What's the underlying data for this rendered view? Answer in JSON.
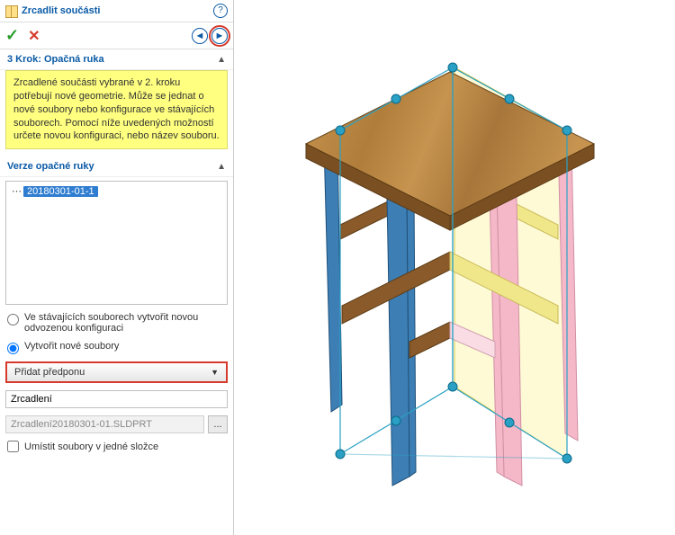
{
  "header": {
    "title": "Zrcadlit součásti"
  },
  "step": {
    "title": "3 Krok: Opačná ruka",
    "info": "Zrcadlené součásti vybrané v 2. kroku potřebují nové geometrie. Může se jednat o nové soubory nebo konfigurace ve stávajících souborech. Pomocí níže uvedených možností určete novou konfiguraci, nebo název souboru."
  },
  "versions": {
    "title": "Verze opačné ruky",
    "tree_prefix": "⋯",
    "selected": "20180301-01-1"
  },
  "options": {
    "radio1": "Ve stávajících souborech vytvořit novou odvozenou konfiguraci",
    "radio2": "Vytvořit nové soubory",
    "select_label": "Přidat předponu",
    "text_value": "Zrcadlení",
    "file_value": "Zrcadlení20180301-01.SLDPRT",
    "file_btn": "...",
    "check_label": "Umístit soubory v jedné složce"
  },
  "icons": {
    "help": "?",
    "ok": "✓",
    "cancel": "✕",
    "back": "◄",
    "next": "►",
    "collapse": "▲",
    "dropdown": "▼"
  }
}
